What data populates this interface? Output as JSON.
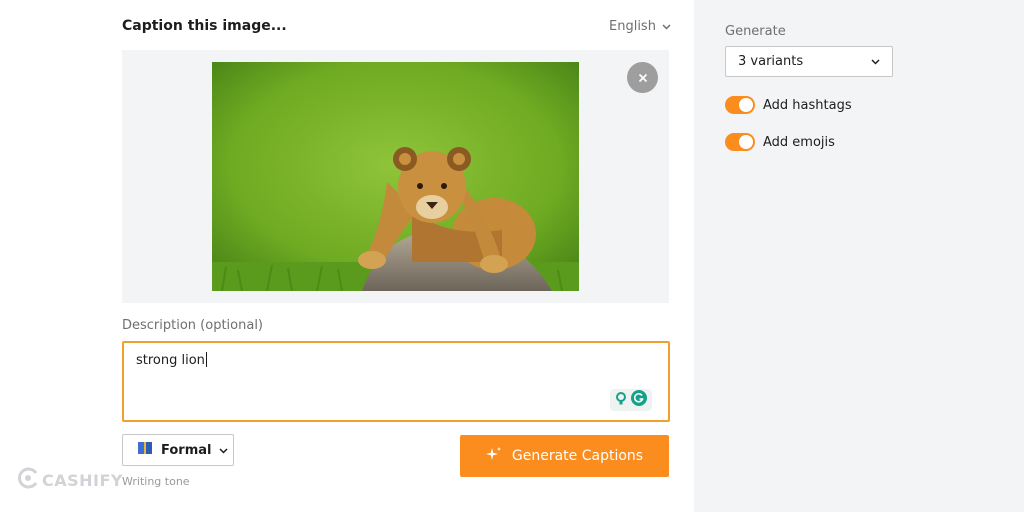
{
  "header": {
    "title": "Caption this image...",
    "language": "English"
  },
  "image": {
    "alt": "lion cub resting on a rock in grass"
  },
  "description": {
    "label": "Description (optional)",
    "value": "strong lion"
  },
  "tone": {
    "value": "Formal",
    "caption": "Writing tone"
  },
  "actions": {
    "generate_label": "Generate Captions"
  },
  "settings": {
    "generate_label": "Generate",
    "variants_value": "3 variants",
    "hashtags_label": "Add hashtags",
    "hashtags_on": true,
    "emojis_label": "Add emojis",
    "emojis_on": true
  },
  "watermark": {
    "text": "CASHIFY"
  },
  "colors": {
    "accent": "#fb8c1e",
    "input_border": "#f0a030",
    "panel_bg": "#f3f4f6"
  }
}
